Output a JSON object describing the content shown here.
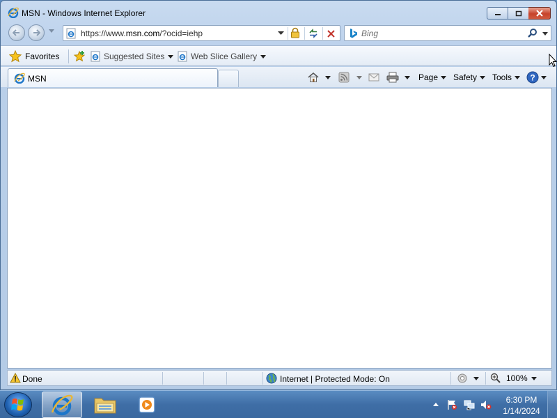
{
  "window": {
    "title": "MSN - Windows Internet Explorer"
  },
  "address": {
    "url_prefix": "https://www.",
    "url_domain": "msn.com",
    "url_suffix": "/?ocid=iehp"
  },
  "search": {
    "placeholder": "Bing"
  },
  "favorites_bar": {
    "favorites_label": "Favorites",
    "items": [
      {
        "label": "Suggested Sites"
      },
      {
        "label": "Web Slice Gallery"
      }
    ]
  },
  "tabs": [
    {
      "label": "MSN"
    }
  ],
  "command_bar": {
    "page_label": "Page",
    "safety_label": "Safety",
    "tools_label": "Tools"
  },
  "status": {
    "text": "Done",
    "zone": "Internet | Protected Mode: On",
    "zoom": "100%"
  },
  "taskbar": {
    "time": "6:30 PM",
    "date": "1/14/2024"
  },
  "colors": {
    "accent": "#1e5fae",
    "close_button": "#c7432a",
    "ie_blue": "#1d76c9"
  }
}
